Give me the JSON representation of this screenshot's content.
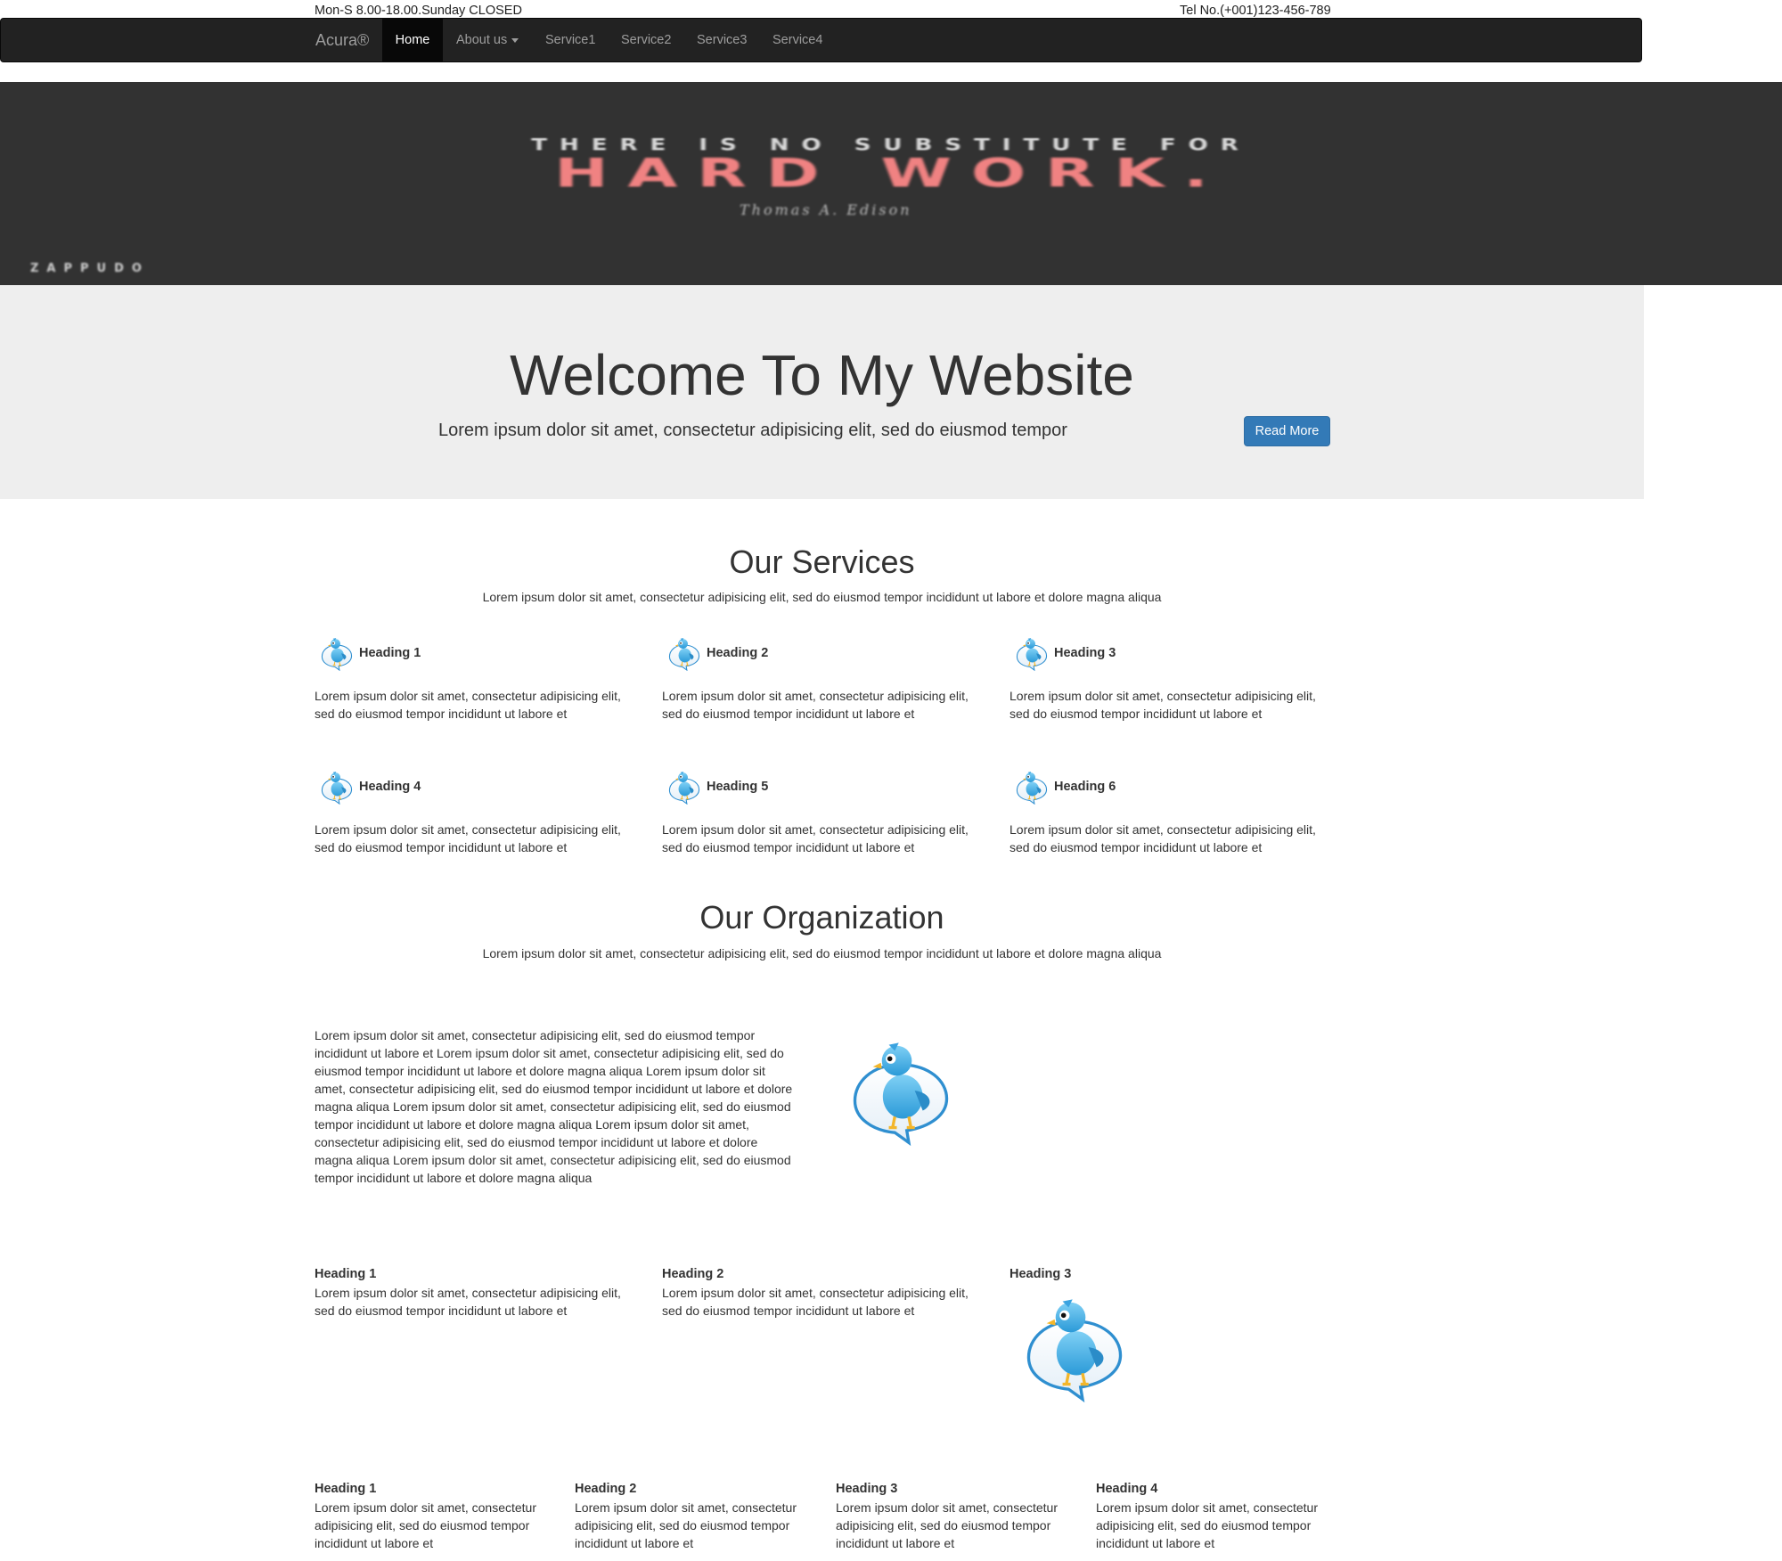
{
  "topbar": {
    "hours": "Mon-S 8.00-18.00.Sunday CLOSED",
    "phone": "Tel No.(+001)123-456-789"
  },
  "navbar": {
    "brand": "Acura®",
    "items": [
      {
        "label": "Home",
        "active": true
      },
      {
        "label": "About us",
        "dropdown": true
      },
      {
        "label": "Service1"
      },
      {
        "label": "Service2"
      },
      {
        "label": "Service3"
      },
      {
        "label": "Service4"
      }
    ]
  },
  "banner": {
    "line1": "THERE IS NO SUBSTITUTE FOR",
    "line2": "HARD WORK.",
    "author": "Thomas A. Edison",
    "brand": "ZAPPUDO"
  },
  "jumbotron": {
    "title": "Welcome To My Website",
    "subtitle": "Lorem ipsum dolor sit amet, consectetur adipisicing elit, sed do eiusmod tempor",
    "button": "Read More"
  },
  "services": {
    "title": "Our Services",
    "subtitle": "Lorem ipsum dolor sit amet, consectetur adipisicing elit, sed do eiusmod tempor incididunt ut labore et dolore magna aliqua",
    "items": [
      {
        "heading": "Heading 1",
        "line1": "Lorem ipsum dolor sit amet, consectetur adipisicing elit,",
        "line2": "sed do eiusmod tempor incididunt ut labore et"
      },
      {
        "heading": "Heading 2",
        "line1": "Lorem ipsum dolor sit amet, consectetur adipisicing elit,",
        "line2": "sed do eiusmod tempor incididunt ut labore et"
      },
      {
        "heading": "Heading 3",
        "line1": "Lorem ipsum dolor sit amet, consectetur adipisicing elit,",
        "line2": "sed do eiusmod tempor incididunt ut labore et"
      },
      {
        "heading": "Heading 4",
        "line1": "Lorem ipsum dolor sit amet, consectetur adipisicing elit,",
        "line2": "sed do eiusmod tempor incididunt ut labore et"
      },
      {
        "heading": "Heading 5",
        "line1": "Lorem ipsum dolor sit amet, consectetur adipisicing elit,",
        "line2": "sed do eiusmod tempor incididunt ut labore et"
      },
      {
        "heading": "Heading 6",
        "line1": "Lorem ipsum dolor sit amet, consectetur adipisicing elit,",
        "line2": "sed do eiusmod tempor incididunt ut labore et"
      }
    ]
  },
  "organization": {
    "title": "Our Organization",
    "subtitle": "Lorem ipsum dolor sit amet, consectetur adipisicing elit, sed do eiusmod tempor incididunt ut labore et dolore magna aliqua",
    "paragraph_lines": [
      "Lorem ipsum dolor sit amet, consectetur adipisicing elit, sed do eiusmod tempor",
      "incididunt ut labore et Lorem ipsum dolor sit amet, consectetur adipisicing elit, sed do",
      "eiusmod tempor incididunt ut labore et dolore magna aliqua Lorem ipsum dolor sit",
      "amet, consectetur adipisicing elit, sed do eiusmod tempor incididunt ut labore et dolore",
      "magna aliqua Lorem ipsum dolor sit amet, consectetur adipisicing elit, sed do eiusmod",
      "tempor incididunt ut labore et dolore magna aliqua Lorem ipsum dolor sit amet,",
      "consectetur adipisicing elit, sed do eiusmod tempor incididunt ut labore et dolore",
      "magna aliqua Lorem ipsum dolor sit amet, consectetur adipisicing elit, sed do eiusmod",
      "tempor incididunt ut labore et dolore magna aliqua"
    ]
  },
  "three_col": [
    {
      "heading": "Heading 1",
      "line1": "Lorem ipsum dolor sit amet, consectetur adipisicing elit,",
      "line2": "sed do eiusmod tempor incididunt ut labore et"
    },
    {
      "heading": "Heading 2",
      "line1": "Lorem ipsum dolor sit amet, consectetur adipisicing elit,",
      "line2": "sed do eiusmod tempor incididunt ut labore et"
    },
    {
      "heading": "Heading 3"
    }
  ],
  "four_col": [
    {
      "heading": "Heading 1",
      "line1": "Lorem ipsum dolor sit amet, consectetur",
      "line2": "adipisicing elit, sed do eiusmod tempor",
      "line3": "incididunt ut labore et"
    },
    {
      "heading": "Heading 2",
      "line1": "Lorem ipsum dolor sit amet, consectetur",
      "line2": "adipisicing elit, sed do eiusmod tempor",
      "line3": "incididunt ut labore et"
    },
    {
      "heading": "Heading 3",
      "line1": "Lorem ipsum dolor sit amet, consectetur",
      "line2": "adipisicing elit, sed do eiusmod tempor",
      "line3": "incididunt ut labore et"
    },
    {
      "heading": "Heading 4",
      "line1": "Lorem ipsum dolor sit amet, consectetur",
      "line2": "adipisicing elit, sed do eiusmod tempor",
      "line3": "incididunt ut labore et"
    }
  ],
  "icons": {
    "service": "twitter-bird-icon",
    "large": "twitter-bird-icon"
  },
  "colors": {
    "navbar": "#222222",
    "banner": "#323232",
    "jumbotron": "#eeeeee",
    "button": "#337ab7",
    "banner_accent": "#f08282"
  }
}
